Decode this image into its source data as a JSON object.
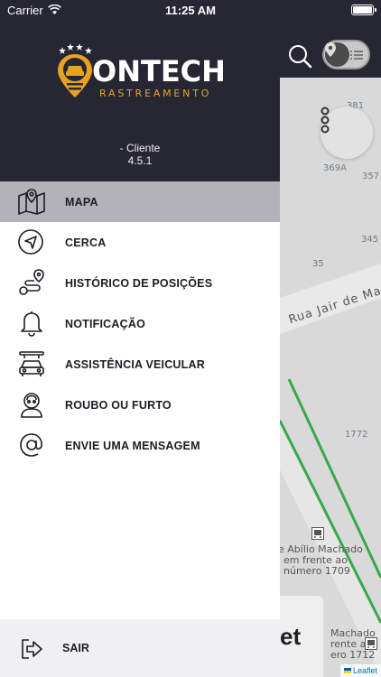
{
  "status_bar": {
    "carrier": "Carrier",
    "time": "11:25 AM"
  },
  "app": {
    "logo_text": "ONTECH",
    "logo_subtitle": "RASTREAMENTO",
    "client_label": "- Cliente",
    "version": "4.5.1"
  },
  "menu": {
    "items": [
      {
        "label": "MAPA",
        "icon": "map-icon",
        "active": true
      },
      {
        "label": "CERCA",
        "icon": "navigation-arrow-icon",
        "active": false
      },
      {
        "label": "HISTÓRICO DE POSIÇÕES",
        "icon": "route-history-icon",
        "active": false
      },
      {
        "label": "NOTIFICAÇÃO",
        "icon": "bell-icon",
        "active": false
      },
      {
        "label": "ASSISTÊNCIA VEICULAR",
        "icon": "car-assistance-icon",
        "active": false
      },
      {
        "label": "ROUBO OU FURTO",
        "icon": "theft-alert-icon",
        "active": false
      },
      {
        "label": "ENVIE UMA MENSAGEM",
        "icon": "at-sign-icon",
        "active": false
      }
    ],
    "logout_label": "SAIR"
  },
  "map": {
    "labels": [
      "381",
      "369A",
      "357",
      "345",
      "35",
      "1772"
    ],
    "street": "Rua Jair de Ma",
    "bus_stop": [
      "e Abílio Machado",
      "em frente ao",
      "número 1709"
    ],
    "bus_stop_2": [
      "Machado",
      "rente ao",
      "ero 1712"
    ],
    "card_text": "et",
    "attribution": "Leaflet"
  },
  "colors": {
    "header_bg": "#272733",
    "accent": "#e8a222",
    "active_item": "#b2b2b8",
    "route": "#3aa84a"
  }
}
